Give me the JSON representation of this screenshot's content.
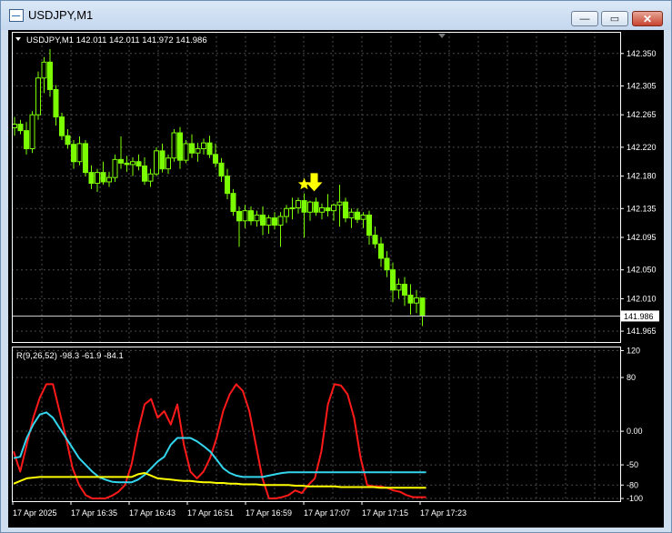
{
  "window": {
    "title": "USDJPY,M1",
    "minimize_glyph": "—",
    "maximize_glyph": "▭",
    "close_glyph": "✕"
  },
  "colors": {
    "bg": "#000000",
    "grid": "#4a4a4a",
    "candle": "#7cfc00",
    "text": "#ffffff",
    "signal": "#ffff00",
    "fast": "#ff1a1a",
    "slow": "#33d6ee",
    "signal_line": "#ffff00",
    "window_frame": "#cfdeef"
  },
  "main_chart": {
    "header": "USDJPY,M1  142.011 142.011 141.972 141.986",
    "current_price": "141.986",
    "price_labels": [
      "142.350",
      "142.305",
      "142.265",
      "142.220",
      "142.180",
      "142.135",
      "142.095",
      "142.050",
      "142.010",
      "141.965"
    ],
    "ylim": [
      141.95,
      142.38
    ],
    "last_price": 141.986,
    "star_index": 49,
    "arrow_index": 51,
    "arrow_icon": "down-arrow-icon",
    "star_icon": "star-icon"
  },
  "indicator": {
    "header": "R(9,26,52) -98.3 -61.9 -84.1",
    "levels": [
      "120",
      "80",
      "0.00",
      "-50",
      "-80",
      "-100"
    ],
    "level_values": [
      120,
      80,
      0,
      -50,
      -80,
      -100
    ],
    "ylim": [
      -104,
      126
    ]
  },
  "time_labels": [
    "17 Apr 2025",
    "17 Apr 16:35",
    "17 Apr 16:43",
    "17 Apr 16:51",
    "17 Apr 16:59",
    "17 Apr 17:07",
    "17 Apr 17:15",
    "17 Apr 17:23"
  ],
  "chart_data": {
    "type": "candlestick",
    "candles": [
      [
        142.247,
        142.262,
        142.236,
        142.252
      ],
      [
        142.252,
        142.258,
        142.238,
        142.243
      ],
      [
        142.243,
        142.255,
        142.21,
        142.218
      ],
      [
        142.218,
        142.27,
        142.212,
        142.265
      ],
      [
        142.265,
        142.325,
        142.258,
        142.316
      ],
      [
        142.316,
        142.345,
        142.295,
        142.338
      ],
      [
        142.338,
        142.356,
        142.29,
        142.3
      ],
      [
        142.3,
        142.306,
        142.25,
        142.262
      ],
      [
        142.262,
        142.268,
        142.23,
        142.236
      ],
      [
        142.236,
        142.245,
        142.218,
        142.224
      ],
      [
        142.224,
        142.23,
        142.19,
        142.2
      ],
      [
        142.2,
        142.235,
        142.195,
        142.225
      ],
      [
        142.225,
        142.23,
        142.18,
        142.185
      ],
      [
        142.185,
        142.195,
        142.162,
        142.17
      ],
      [
        142.17,
        142.19,
        142.158,
        142.185
      ],
      [
        142.185,
        142.2,
        142.168,
        142.172
      ],
      [
        142.172,
        142.186,
        142.165,
        142.178
      ],
      [
        142.178,
        142.21,
        142.172,
        142.203
      ],
      [
        142.203,
        142.235,
        142.19,
        142.198
      ],
      [
        142.198,
        142.208,
        142.186,
        142.196
      ],
      [
        142.196,
        142.206,
        142.18,
        142.2
      ],
      [
        142.2,
        142.21,
        142.188,
        142.194
      ],
      [
        142.194,
        142.206,
        142.168,
        142.173
      ],
      [
        142.173,
        142.19,
        142.165,
        142.183
      ],
      [
        142.183,
        142.22,
        142.18,
        142.215
      ],
      [
        142.215,
        142.225,
        142.185,
        142.19
      ],
      [
        142.19,
        142.21,
        142.183,
        142.205
      ],
      [
        142.205,
        142.245,
        142.2,
        142.24
      ],
      [
        142.24,
        142.248,
        142.19,
        142.202
      ],
      [
        142.202,
        142.23,
        142.198,
        142.225
      ],
      [
        142.225,
        142.238,
        142.205,
        142.212
      ],
      [
        142.212,
        142.226,
        142.2,
        142.218
      ],
      [
        142.218,
        142.232,
        142.21,
        142.226
      ],
      [
        142.226,
        142.236,
        142.205,
        142.21
      ],
      [
        142.21,
        142.225,
        142.192,
        142.198
      ],
      [
        142.198,
        142.205,
        142.172,
        142.18
      ],
      [
        142.18,
        142.19,
        142.148,
        142.156
      ],
      [
        142.156,
        142.162,
        142.125,
        142.131
      ],
      [
        142.131,
        142.138,
        142.082,
        142.118
      ],
      [
        142.118,
        142.14,
        142.108,
        142.132
      ],
      [
        142.132,
        142.138,
        142.112,
        142.118
      ],
      [
        142.118,
        142.132,
        142.11,
        142.126
      ],
      [
        142.126,
        142.138,
        142.098,
        142.112
      ],
      [
        142.112,
        142.126,
        142.1,
        142.122
      ],
      [
        142.122,
        142.13,
        142.106,
        142.112
      ],
      [
        142.112,
        142.13,
        142.082,
        142.124
      ],
      [
        142.124,
        142.14,
        142.115,
        142.135
      ],
      [
        142.135,
        142.15,
        142.12,
        142.136
      ],
      [
        142.136,
        142.15,
        142.128,
        142.146
      ],
      [
        142.146,
        142.156,
        142.095,
        142.13
      ],
      [
        142.13,
        142.146,
        142.118,
        142.144
      ],
      [
        142.144,
        142.15,
        142.125,
        142.13
      ],
      [
        142.13,
        142.142,
        142.12,
        142.136
      ],
      [
        142.136,
        142.155,
        142.124,
        142.132
      ],
      [
        142.132,
        142.142,
        142.118,
        142.14
      ],
      [
        142.14,
        142.168,
        142.11,
        142.144
      ],
      [
        142.144,
        142.15,
        142.116,
        142.122
      ],
      [
        142.122,
        142.135,
        142.108,
        142.13
      ],
      [
        142.13,
        142.135,
        142.115,
        142.12
      ],
      [
        142.12,
        142.13,
        142.108,
        142.126
      ],
      [
        142.126,
        142.132,
        142.085,
        142.098
      ],
      [
        142.098,
        142.11,
        142.08,
        142.086
      ],
      [
        142.086,
        142.095,
        142.054,
        142.066
      ],
      [
        142.066,
        142.076,
        142.04,
        142.05
      ],
      [
        142.05,
        142.06,
        142.005,
        142.022
      ],
      [
        142.022,
        142.038,
        142.01,
        142.03
      ],
      [
        142.03,
        142.04,
        142.0,
        142.015
      ],
      [
        142.015,
        142.03,
        141.988,
        142.004
      ],
      [
        142.004,
        142.022,
        141.99,
        142.011
      ],
      [
        142.011,
        142.011,
        141.972,
        141.986
      ]
    ],
    "indicator_series": [
      {
        "name": "fast",
        "values": [
          -30,
          -60,
          -20,
          20,
          50,
          70,
          70,
          30,
          -10,
          -55,
          -80,
          -95,
          -100,
          -100,
          -100,
          -96,
          -90,
          -80,
          -50,
          0,
          40,
          48,
          20,
          30,
          10,
          40,
          -20,
          -60,
          -70,
          -60,
          -40,
          -10,
          30,
          55,
          70,
          60,
          30,
          -20,
          -70,
          -100,
          -100,
          -98,
          -95,
          -88,
          -92,
          -80,
          -70,
          -30,
          40,
          70,
          68,
          55,
          20,
          -40,
          -80,
          -82,
          -82,
          -84,
          -88,
          -90,
          -95,
          -98,
          -98,
          -98
        ]
      },
      {
        "name": "slow",
        "values": [
          -40,
          -38,
          -10,
          10,
          25,
          28,
          20,
          5,
          -10,
          -25,
          -40,
          -50,
          -60,
          -68,
          -72,
          -75,
          -76,
          -76,
          -76,
          -72,
          -65,
          -55,
          -45,
          -38,
          -20,
          -10,
          -10,
          -10,
          -15,
          -22,
          -30,
          -42,
          -55,
          -62,
          -66,
          -68,
          -68,
          -68,
          -68,
          -66,
          -64,
          -62,
          -61,
          -61,
          -61,
          -61,
          -61,
          -61,
          -61,
          -61,
          -61,
          -61,
          -61,
          -61,
          -61,
          -61,
          -61,
          -61,
          -61,
          -61,
          -61,
          -61,
          -61,
          -61
        ]
      },
      {
        "name": "signal",
        "values": [
          -78,
          -74,
          -70,
          -69,
          -68,
          -68,
          -68,
          -68,
          -68,
          -68,
          -68,
          -68,
          -68,
          -68,
          -68,
          -68,
          -68,
          -68,
          -68,
          -64,
          -62,
          -66,
          -70,
          -71,
          -72,
          -73,
          -74,
          -74,
          -75,
          -76,
          -76,
          -77,
          -77,
          -78,
          -78,
          -79,
          -79,
          -79,
          -80,
          -80,
          -80,
          -80,
          -80,
          -81,
          -81,
          -82,
          -82,
          -82,
          -82,
          -82,
          -83,
          -83,
          -83,
          -83,
          -83,
          -83,
          -84,
          -84,
          -84,
          -84,
          -84,
          -84,
          -84,
          -84
        ]
      }
    ]
  }
}
